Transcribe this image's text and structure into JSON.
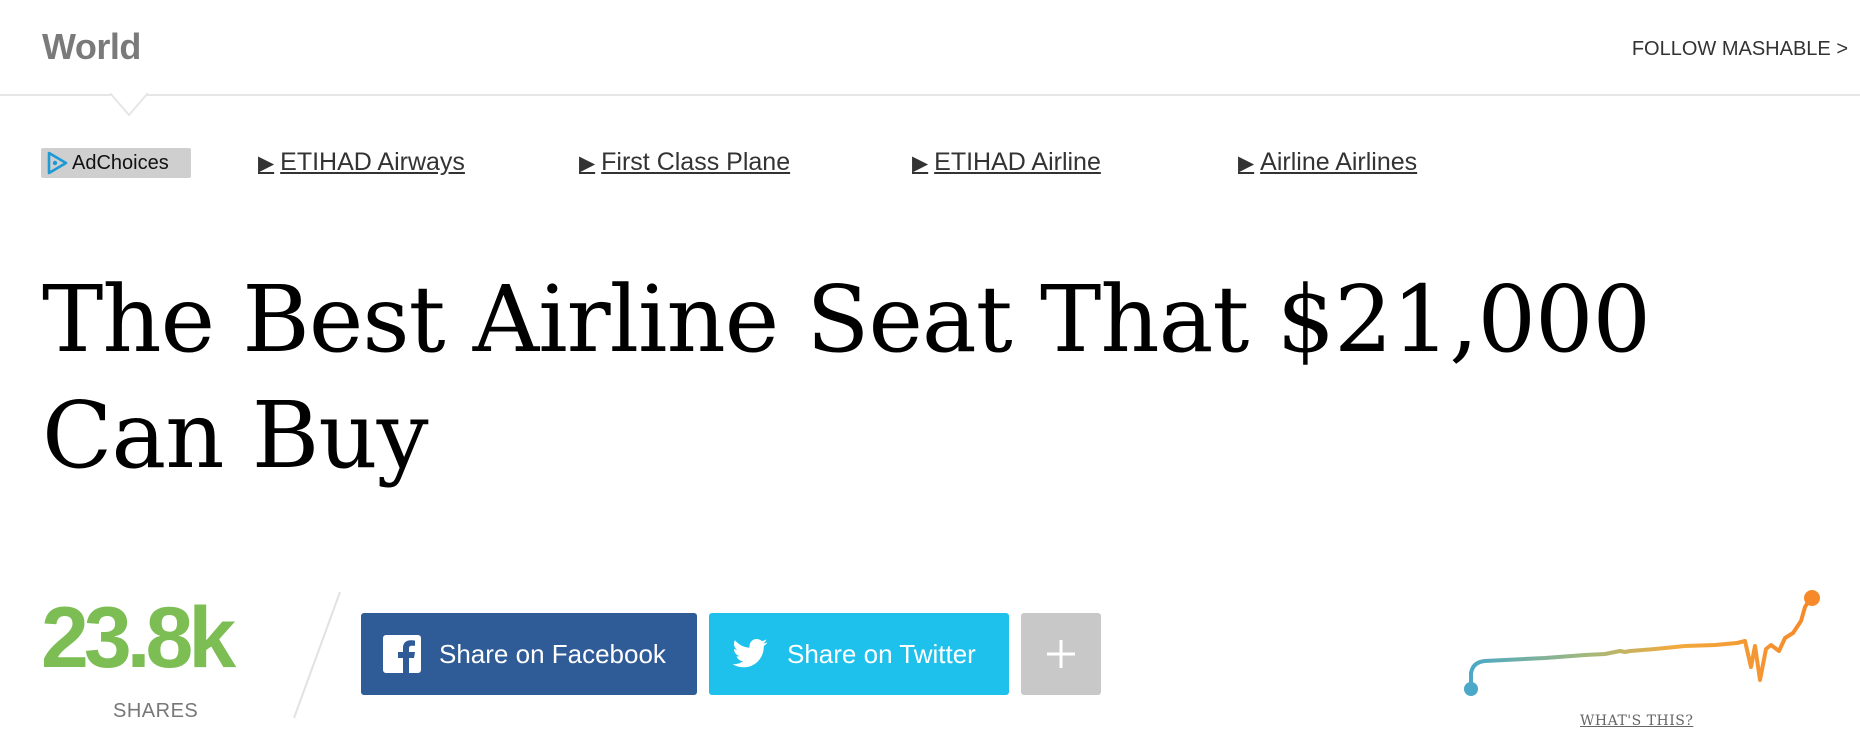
{
  "header": {
    "section": "World",
    "follow": "FOLLOW MASHABLE >"
  },
  "ads": {
    "adchoices_label": "AdChoices",
    "links": [
      {
        "arrow": "▶",
        "text": "ETIHAD Airways"
      },
      {
        "arrow": "▶",
        "text": "First Class Plane"
      },
      {
        "arrow": "▶",
        "text": "ETIHAD Airline"
      },
      {
        "arrow": "▶",
        "text": "Airline Airlines"
      }
    ]
  },
  "article": {
    "title": "The Best Airline Seat That $21,000 Can Buy"
  },
  "shares": {
    "count": "23.8k",
    "label": "SHARES"
  },
  "share_buttons": {
    "facebook": "Share on Facebook",
    "twitter": "Share on Twitter",
    "more": "+"
  },
  "velocity": {
    "whats_this": "WHAT'S THIS?"
  },
  "colors": {
    "share_count": "#7cbd54",
    "facebook": "#2f5b97",
    "twitter": "#1dc1ec",
    "more": "#c8c8c8",
    "velocity_start": "#4aa8c8",
    "velocity_end": "#f6892a"
  },
  "icons": [
    "adchoices-icon",
    "facebook-icon",
    "twitter-icon",
    "plus-icon",
    "pointer-caret"
  ]
}
